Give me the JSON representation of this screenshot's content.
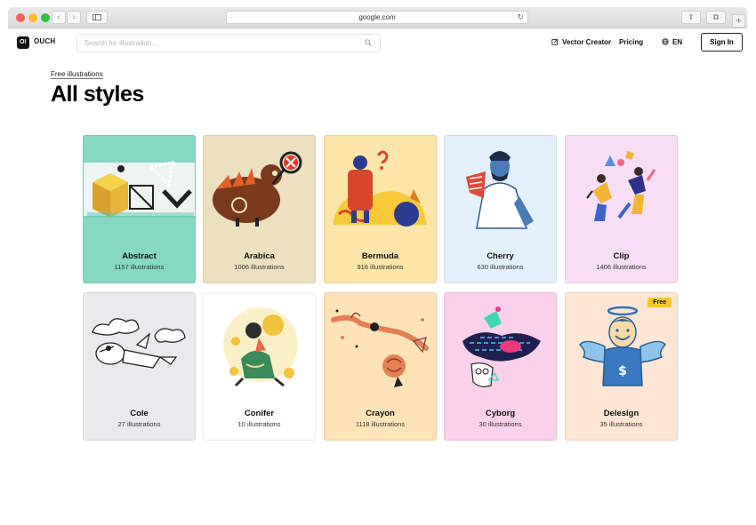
{
  "browser": {
    "url": "google.com",
    "icons": [
      "back-arrow-icon",
      "forward-arrow-icon",
      "sidebar-icon",
      "reload-icon",
      "share-icon",
      "tabs-icon",
      "plus-icon"
    ]
  },
  "header": {
    "logo_mark": "O!",
    "logo_text": "OUCH",
    "search_placeholder": "Search for illustration...",
    "vector_creator": "Vector Creator",
    "pricing": "Pricing",
    "language": "EN",
    "signin": "Sign In"
  },
  "page": {
    "breadcrumb": "Free illustrations",
    "title": "All styles"
  },
  "styles": [
    {
      "name": "Abstract",
      "count": "1157 illustrations",
      "bg": "#86d8c2"
    },
    {
      "name": "Arabica",
      "count": "1006 illustrations",
      "bg": "#ece0bf"
    },
    {
      "name": "Bermuda",
      "count": "916 illustrations",
      "bg": "#fde6a8"
    },
    {
      "name": "Cherry",
      "count": "630 illustrations",
      "bg": "#e2f1fc"
    },
    {
      "name": "Clip",
      "count": "1406 illustrations",
      "bg": "#f6def4"
    },
    {
      "name": "Cole",
      "count": "27 illustrations",
      "bg": "#e9eaec"
    },
    {
      "name": "Conifer",
      "count": "10 illustrations",
      "bg": "#ffffff"
    },
    {
      "name": "Crayon",
      "count": "1118 illustrations",
      "bg": "#fde3b6"
    },
    {
      "name": "Cyborg",
      "count": "30 illustrations",
      "bg": "#fbd0ea"
    },
    {
      "name": "Delesign",
      "count": "35 illustrations",
      "bg": "#fde6d3",
      "badge": "Free"
    }
  ]
}
